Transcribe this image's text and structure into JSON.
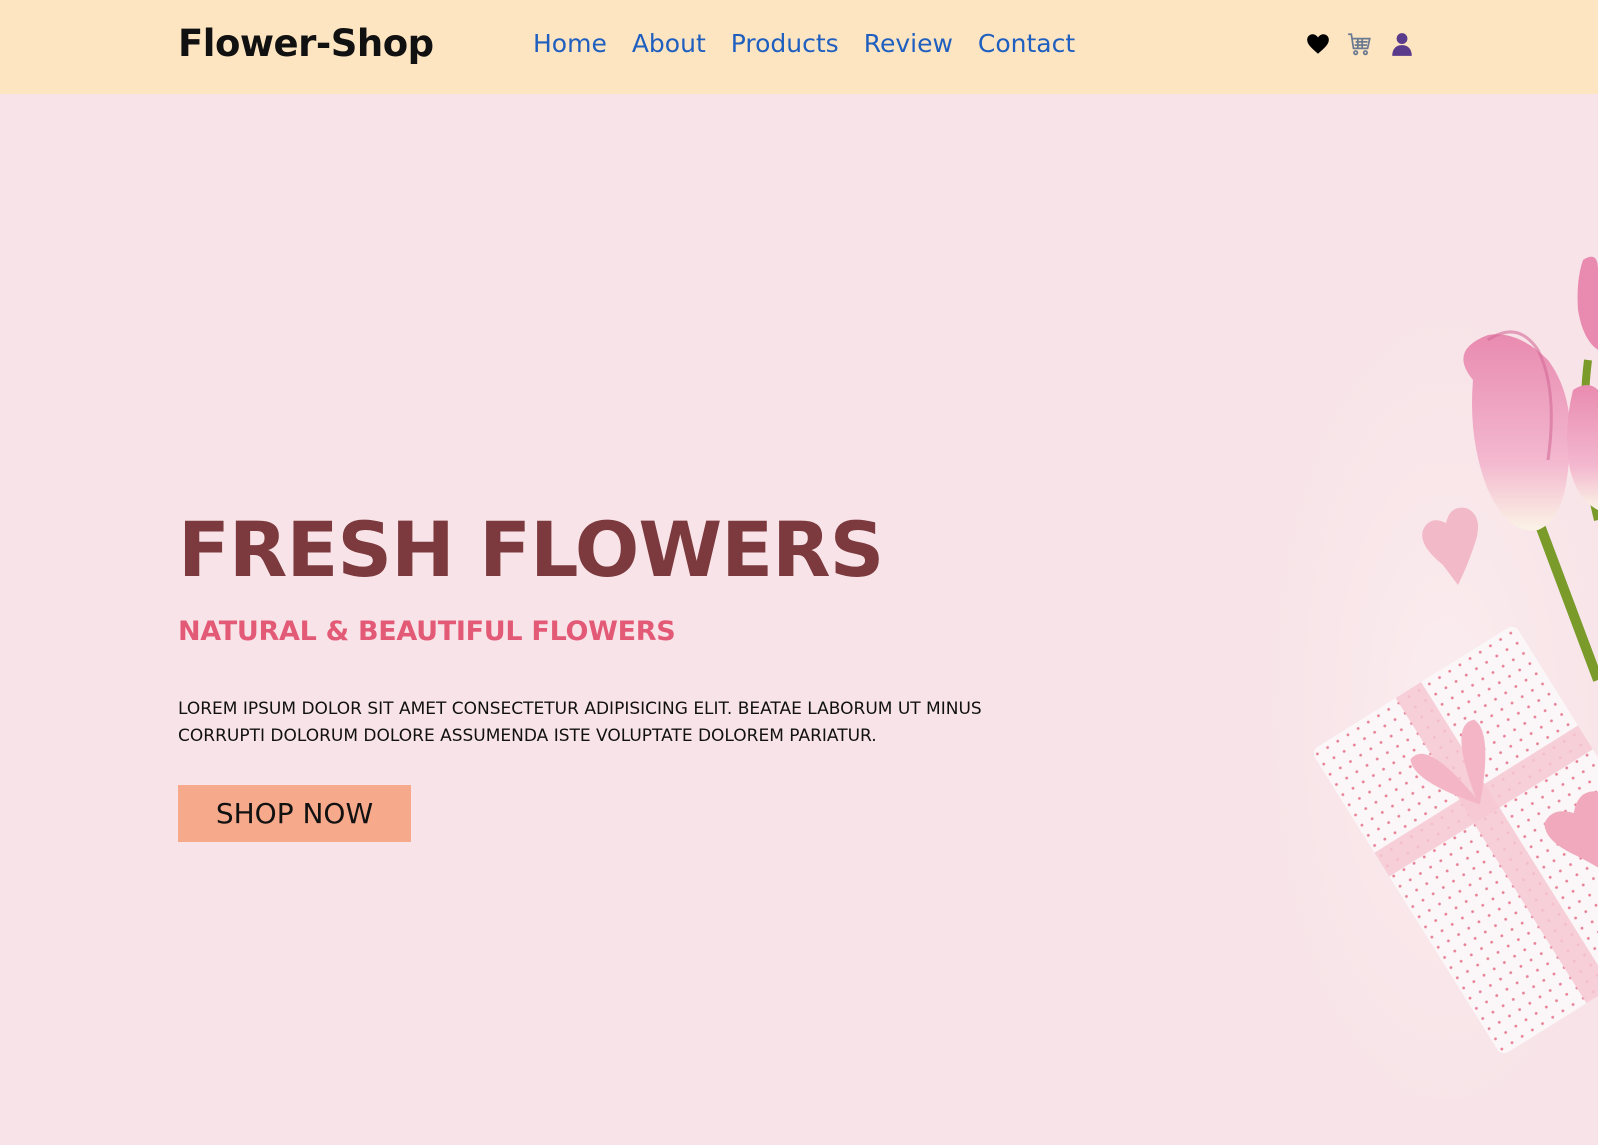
{
  "header": {
    "logo": "Flower-Shop",
    "nav": [
      "Home",
      "About",
      "Products",
      "Review",
      "Contact"
    ],
    "icons": [
      "heart-icon",
      "cart-icon",
      "user-icon"
    ]
  },
  "hero": {
    "title": "FRESH FLOWERS",
    "subtitle": "NATURAL & BEAUTIFUL FLOWERS",
    "description": "LOREM IPSUM DOLOR SIT AMET CONSECTETUR ADIPISICING ELIT. BEATAE LABORUM UT MINUS CORRUPTI DOLORUM DOLORE ASSUMENDA ISTE VOLUPTATE DOLOREM PARIATUR.",
    "button": "SHOP NOW"
  },
  "colors": {
    "header_bg": "#fde5c2",
    "page_bg": "#f8e4e8",
    "nav_link": "#1f5fbf",
    "title": "#7c3a3e",
    "subtitle": "#e35a77",
    "button_bg": "#f6a98b"
  }
}
